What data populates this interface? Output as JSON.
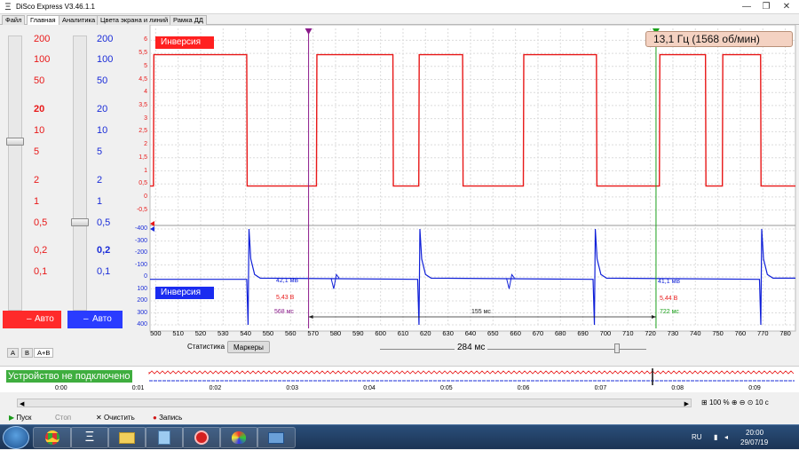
{
  "window": {
    "title": "DiSco Express V3.46.1.1"
  },
  "tabs": [
    "Файл",
    "Главная",
    "Аналитика",
    "Цвета экрана и линий",
    "Рамка ДД"
  ],
  "left_panel": {
    "scale_a": [
      "200",
      "100",
      "50",
      "20",
      "10",
      "5",
      "2",
      "1",
      "0,5",
      "0,2",
      "0,1"
    ],
    "scale_b": [
      "200",
      "100",
      "50",
      "20",
      "10",
      "5",
      "2",
      "1",
      "0,5",
      "0,2",
      "0,1"
    ],
    "scale_a_bold": "20",
    "scale_b_bold": "0,2",
    "auto_a": "Авто",
    "auto_b": "Авто",
    "channel_tabs": [
      "A",
      "B",
      "A+B"
    ]
  },
  "plot": {
    "channel_a": {
      "label": "Инверсия",
      "color": "#e81818",
      "y_ticks": [
        "6",
        "5,5",
        "5",
        "4,5",
        "4",
        "3,5",
        "3",
        "2,5",
        "2",
        "1,5",
        "1",
        "0,5",
        "0",
        "-0,5"
      ]
    },
    "channel_b": {
      "label": "Инверсия",
      "color": "#1020d8",
      "y_ticks": [
        "-400",
        "-300",
        "-200",
        "-100",
        "0",
        "100",
        "200",
        "300",
        "400"
      ]
    },
    "x_ticks": [
      "500",
      "510",
      "520",
      "530",
      "540",
      "550",
      "560",
      "570",
      "580",
      "590",
      "600",
      "610",
      "620",
      "630",
      "640",
      "650",
      "660",
      "670",
      "680",
      "690",
      "700",
      "710",
      "720",
      "730",
      "740",
      "750",
      "760",
      "770",
      "780"
    ],
    "frequency": "13,1 Гц (1568 об/мин)",
    "cursor1": {
      "b_value": "42,1 мВ",
      "a_value": "5,43 В",
      "time": "568 мс",
      "color": "#8a1a8a"
    },
    "cursor2": {
      "b_value": "41,1 мВ",
      "a_value": "5,44 В",
      "time": "722 мс",
      "color": "#1aa01a"
    },
    "delta": "155 мс",
    "window_span": "284 мс",
    "bottom_tabs": [
      "Статистика",
      "Маркеры"
    ]
  },
  "overview": {
    "status": "Устройство не подключено",
    "ticks": [
      "0:00",
      "0:01",
      "0:02",
      "0:03",
      "0:04",
      "0:05",
      "0:06",
      "0:07",
      "0:08",
      "0:09"
    ]
  },
  "zoom": {
    "percent": "100 %",
    "time": "10 с"
  },
  "controls": {
    "play": "Пуск",
    "stop": "Стоп",
    "clear": "Очистить",
    "record": "Запись"
  },
  "tray": {
    "lang": "RU",
    "time": "20:00",
    "date": "29/07/19"
  },
  "icons": [
    "start-orb-icon",
    "chrome-icon",
    "disco-icon",
    "folder-icon",
    "notepad-icon",
    "record-app-icon",
    "paint-icon",
    "screenshot-icon"
  ]
}
